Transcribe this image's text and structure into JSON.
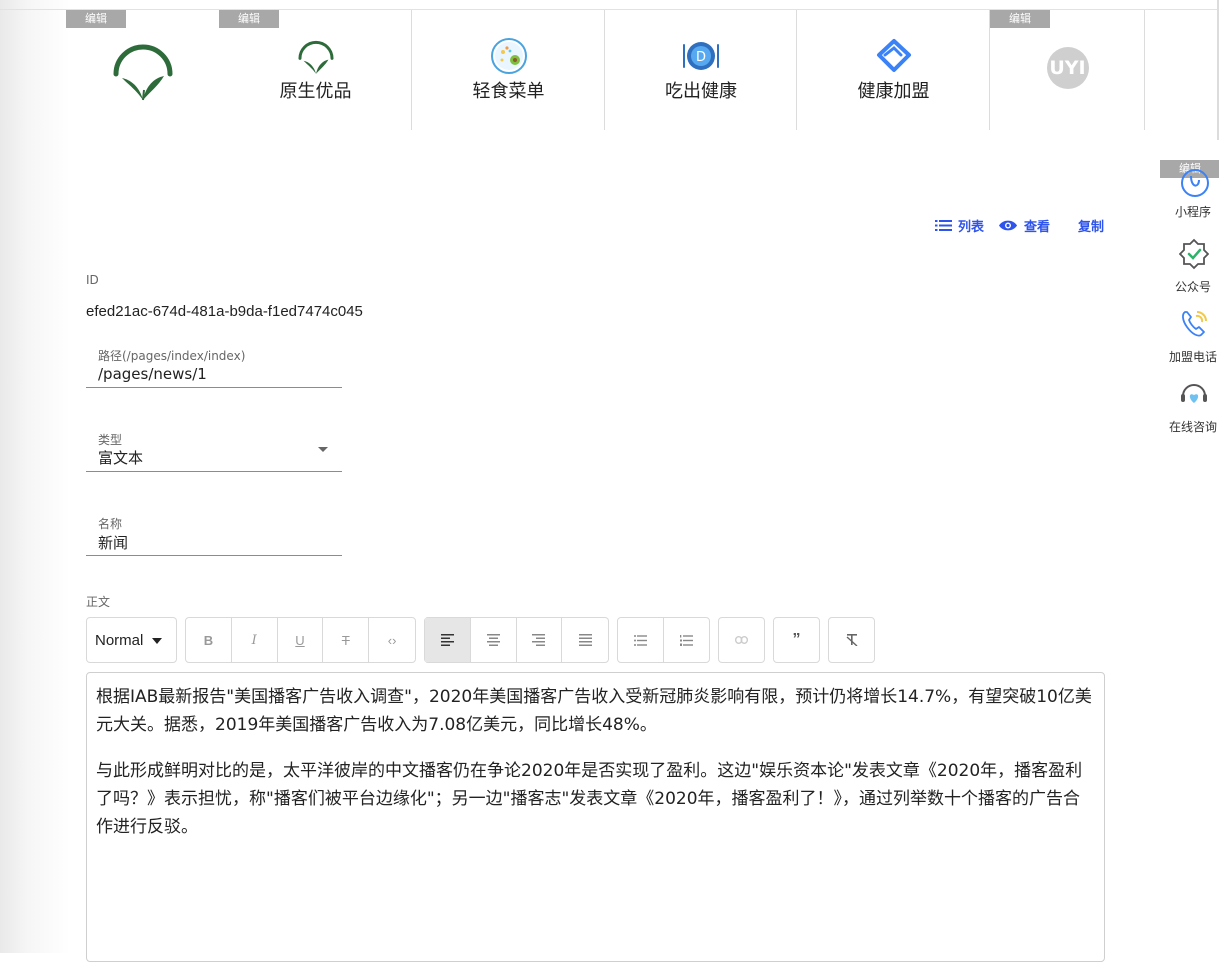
{
  "nav": {
    "edit_label": "编辑",
    "items": [
      {
        "label": "",
        "icon": "leaf-logo-icon"
      },
      {
        "label": "原生优品",
        "icon": "leaf-logo-icon"
      },
      {
        "label": "轻食菜单",
        "icon": "salad-bowl-icon"
      },
      {
        "label": "吃出健康",
        "icon": "plate-utensils-icon"
      },
      {
        "label": "健康加盟",
        "icon": "handshake-icon"
      },
      {
        "label": "",
        "icon": "uyi-avatar-icon",
        "avatar_text": "UYI"
      }
    ]
  },
  "side": {
    "edit_label": "编辑",
    "items": [
      {
        "label": "小程序",
        "icon": "mini-program-icon"
      },
      {
        "label": "公众号",
        "icon": "official-account-icon"
      },
      {
        "label": "加盟电话",
        "icon": "phone-icon"
      },
      {
        "label": "在线咨询",
        "icon": "support-headset-icon"
      }
    ]
  },
  "actions": {
    "list": "列表",
    "view": "查看",
    "copy": "复制"
  },
  "form": {
    "id_label": "ID",
    "id_value": "efed21ac-674d-481a-b9da-f1ed7474c045",
    "path_label": "路径(/pages/index/index)",
    "path_value": "/pages/news/1",
    "type_label": "类型",
    "type_value": "富文本",
    "name_label": "名称",
    "name_value": "新闻",
    "body_label": "正文"
  },
  "editor": {
    "format_select": "Normal",
    "toolbar_icons": [
      "bold-icon",
      "italic-icon",
      "underline-icon",
      "strike-icon",
      "code-icon",
      "align-left-icon",
      "align-center-icon",
      "align-right-icon",
      "align-justify-icon",
      "bullet-list-icon",
      "ordered-list-icon",
      "link-icon",
      "quote-icon",
      "clear-format-icon"
    ],
    "paragraphs": [
      "根据IAB最新报告\"美国播客广告收入调查\"，2020年美国播客广告收入受新冠肺炎影响有限，预计仍将增长14.7%，有望突破10亿美元大关。据悉，2019年美国播客广告收入为7.08亿美元，同比增长48%。",
      "与此形成鲜明对比的是，太平洋彼岸的中文播客仍在争论2020年是否实现了盈利。这边\"娱乐资本论\"发表文章《2020年，播客盈利了吗？》表示担忧，称\"播客们被平台边缘化\"；另一边\"播客志\"发表文章《2020年，播客盈利了！》，通过列举数十个播客的广告合作进行反驳。"
    ]
  },
  "colors": {
    "accent": "#2f54eb",
    "badge": "#a8a8a8",
    "leaf_green": "#2e6b3a"
  }
}
